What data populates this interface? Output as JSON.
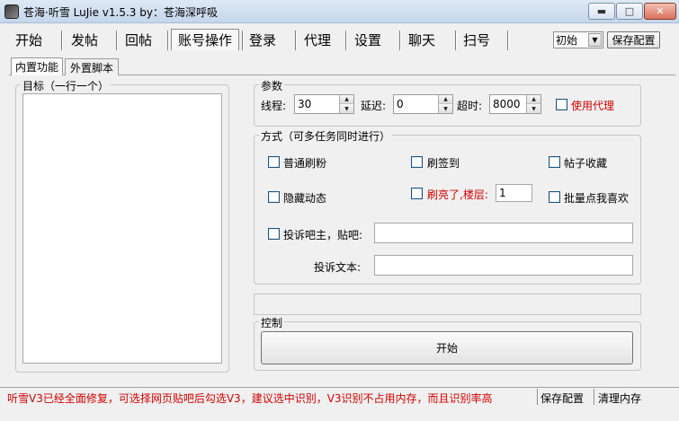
{
  "window": {
    "title": "苍海·听雪  LuJie  v1.5.3  by：苍海深呼吸",
    "min_glyph": "▬",
    "max_glyph": "□",
    "close_glyph": "✕"
  },
  "top_tabs": [
    "开始",
    "发帖",
    "回帖",
    "账号操作",
    "登录",
    "代理",
    "设置",
    "聊天",
    "扫号"
  ],
  "active_top_tab": "账号操作",
  "profile_select": {
    "value": "初始",
    "arrow": "▼"
  },
  "save_config_top": "保存配置",
  "sub_tabs": [
    "内置功能",
    "外置脚本"
  ],
  "target_group": {
    "label": "目标（一行一个）"
  },
  "params": {
    "label": "参数",
    "threads_label": "线程:",
    "threads_value": "30",
    "delay_label": "延迟:",
    "delay_value": "0",
    "timeout_label": "超时:",
    "timeout_value": "8000",
    "use_proxy": "使用代理",
    "spin_up": "▲",
    "spin_down": "▼"
  },
  "methods": {
    "label": "方式（可多任务同时进行）",
    "normal_fans": "普通刷粉",
    "sign_in": "刷签到",
    "favorite_post": "帖子收藏",
    "hide_activity": "隐藏动态",
    "brush_light": "刷亮了,楼层:",
    "floor_value": "1",
    "batch_like": "批量点我喜欢",
    "report_admin": "投诉吧主，贴吧:",
    "report_text_label": "投诉文本:"
  },
  "control": {
    "label": "控制",
    "start_button": "开始"
  },
  "status_bar": {
    "message": "听雪V3已经全面修复，可选择网页贴吧后勾选V3，建议选中识别，V3识别不占用内存，而且识别率高",
    "save_config": "保存配置",
    "clear_memory": "清理内存"
  },
  "colors": {
    "accent_red": "#d00000",
    "window_bg": "#f0f0f0"
  }
}
